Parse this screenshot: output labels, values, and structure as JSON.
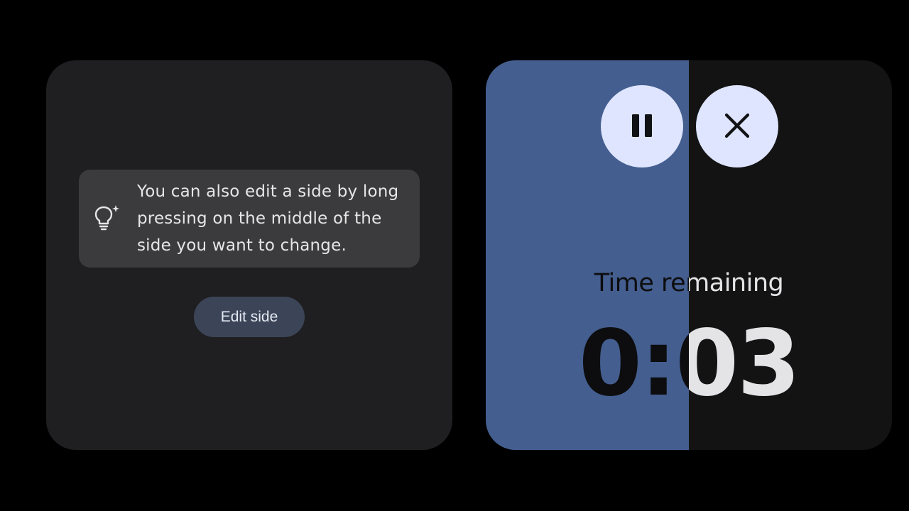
{
  "left_panel": {
    "tip": {
      "icon": "lightbulb-sparkle-icon",
      "text": "You can also edit a side by long pressing on the middle of the side you want to change."
    },
    "edit_button_label": "Edit side"
  },
  "timer": {
    "progress_fraction": 0.5,
    "pause_icon": "pause-icon",
    "close_icon": "close-icon",
    "label": "Time remaining",
    "value": "0:03"
  },
  "colors": {
    "background": "#000000",
    "left_panel_bg": "#1f1f22",
    "tip_card_bg": "#3b3b3d",
    "edit_button_bg": "#3c4557",
    "right_panel_bg": "#131314",
    "progress_fill": "#445e8f",
    "round_button_bg": "#dfe5ff"
  }
}
